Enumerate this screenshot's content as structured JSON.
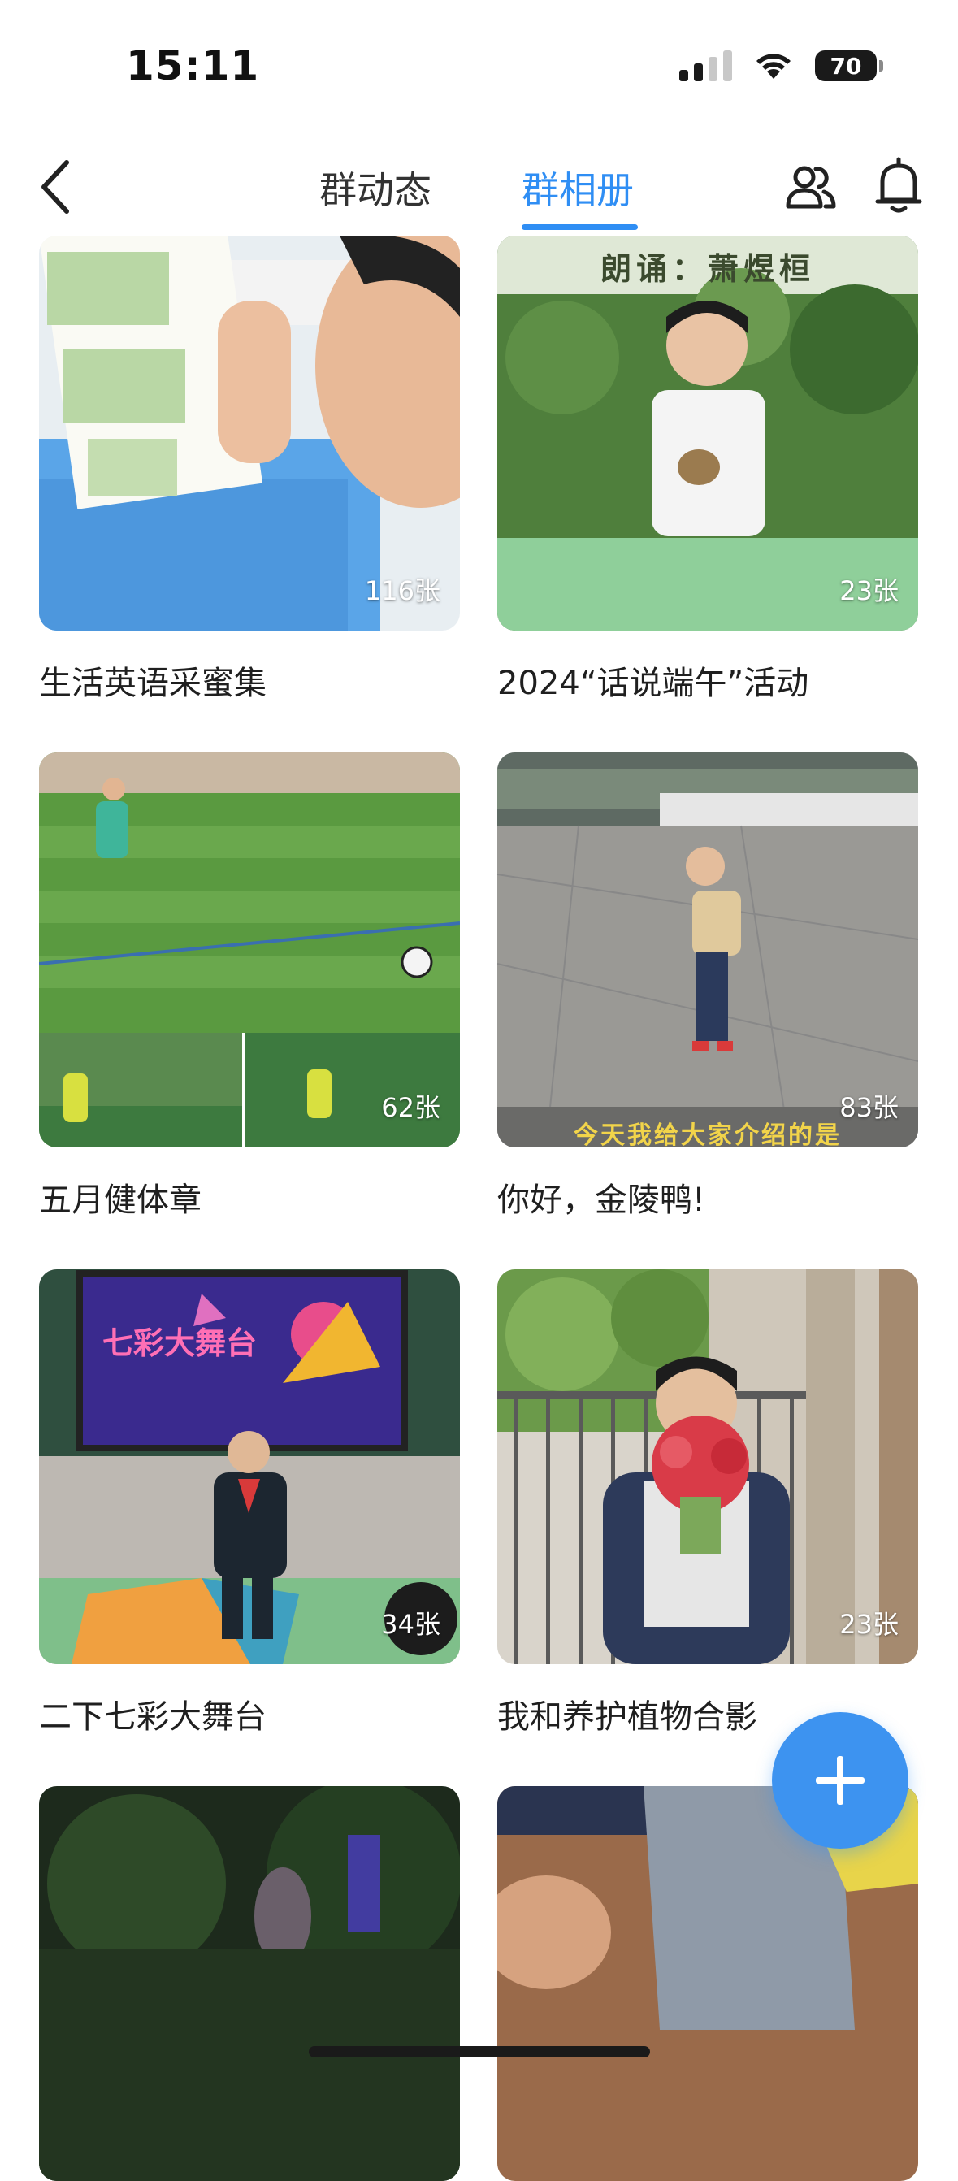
{
  "status_bar": {
    "time": "15:11",
    "battery": "70",
    "icons": [
      "signal-icon",
      "wifi-icon",
      "battery-icon"
    ]
  },
  "nav": {
    "tabs": [
      {
        "label": "群动态",
        "active": false
      },
      {
        "label": "群相册",
        "active": true
      }
    ],
    "accent_color": "#2f8ef4",
    "icons": [
      "back-icon",
      "members-icon",
      "bell-icon"
    ]
  },
  "albums": [
    {
      "title": "生活英语采蜜集",
      "count": "116张"
    },
    {
      "title": "2024“话说端午”活动",
      "count": "23张",
      "caption": "朗诵：萧煜桓"
    },
    {
      "title": "五月健体章",
      "count": "62张"
    },
    {
      "title": "你好，金陵鸭!",
      "count": "83张",
      "caption": "今天我给大家介绍的是"
    },
    {
      "title": "二下七彩大舞台",
      "count": "34张",
      "caption": "七彩大舞台"
    },
    {
      "title": "我和养护植物合影",
      "count": "23张"
    },
    {
      "title": "",
      "count": ""
    },
    {
      "title": "",
      "count": ""
    }
  ],
  "fab": {
    "icon": "plus-icon"
  }
}
